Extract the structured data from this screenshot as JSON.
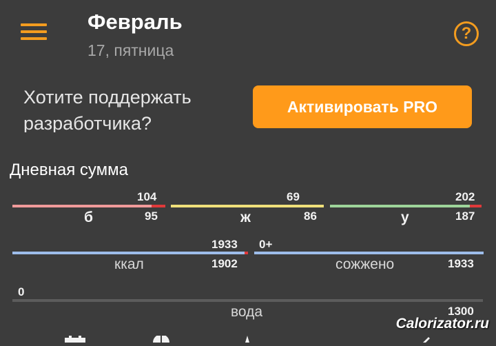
{
  "header": {
    "month": "Февраль",
    "date": "17, пятница",
    "menu_icon": "hamburger-menu-icon",
    "help_icon": "question-circle-icon",
    "help_glyph": "?"
  },
  "promo": {
    "text": "Хотите поддержать разработчика?",
    "button_label": "Активировать PRO"
  },
  "daily": {
    "title": "Дневная сумма",
    "protein": {
      "label": "б",
      "goal": "104",
      "current": "95",
      "progress": 0.913,
      "color": "#f09a9a"
    },
    "fat": {
      "label": "ж",
      "goal": "69",
      "current": "86",
      "progress": 1.0,
      "color": "#efe07a"
    },
    "carbs": {
      "label": "у",
      "goal": "202",
      "current": "187",
      "progress": 0.926,
      "color": "#9ed49a"
    },
    "kcal": {
      "label": "ккал",
      "goal": "1933",
      "current": "1902",
      "progress": 0.984,
      "color": "#9dbdea"
    },
    "burned": {
      "label": "сожжено",
      "goal": "0+",
      "current": "1933",
      "progress": 1.0,
      "color": "#9dbdea"
    },
    "water": {
      "label": "вода",
      "current": "0",
      "goal": "1300",
      "progress": 0.0,
      "color": "#9dbdea"
    }
  },
  "watermark": "Calorizator.ru",
  "colors": {
    "accent": "#f39c1f",
    "button": "#ff9a1a",
    "background": "#3c3c3c",
    "over_limit": "#e0393a"
  }
}
